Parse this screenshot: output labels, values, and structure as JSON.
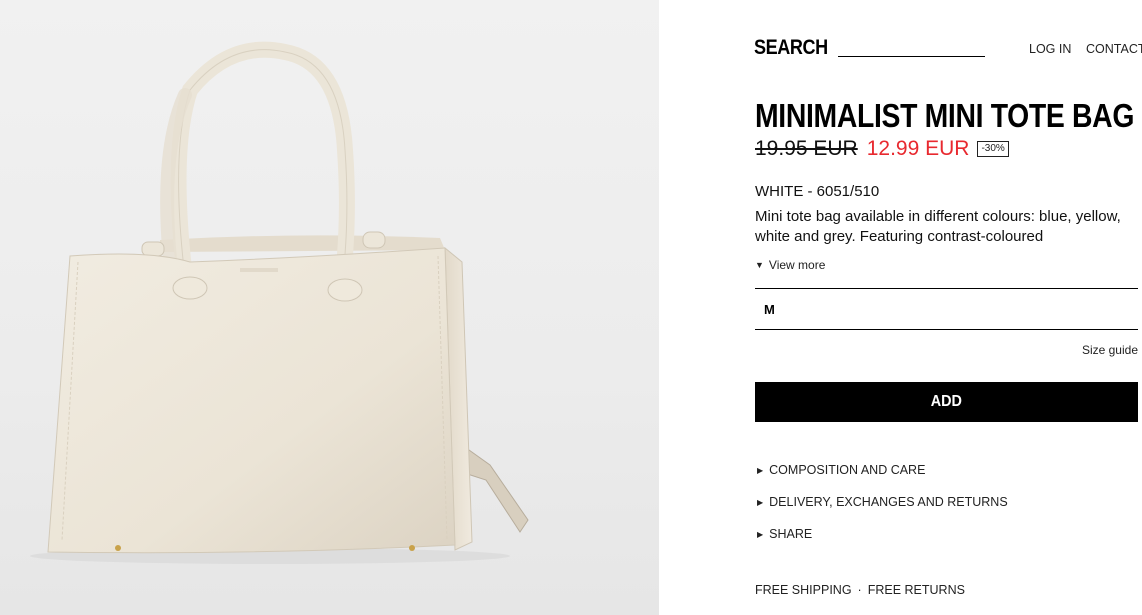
{
  "header": {
    "search_label": "SEARCH",
    "login_label": "LOG IN",
    "contact_label": "CONTACT"
  },
  "product": {
    "title": "MINIMALIST MINI TOTE BAG",
    "price_old": "19.95 EUR",
    "price_new": "12.99 EUR",
    "discount_badge": "-30%",
    "color_ref": "WHITE - 6051/510",
    "description": "Mini tote bag available in different colours: blue, yellow, white and grey. Featuring contrast-coloured",
    "view_more": "View more",
    "size_selected": "M",
    "size_guide": "Size guide",
    "add_label": "ADD",
    "image_name": "product-image"
  },
  "accordion": [
    {
      "label": "COMPOSITION AND CARE"
    },
    {
      "label": "DELIVERY, EXCHANGES AND RETURNS"
    },
    {
      "label": "SHARE"
    }
  ],
  "footer": {
    "shipping": "FREE SHIPPING",
    "separator": "·",
    "returns": "FREE RETURNS"
  },
  "colors": {
    "sale_red": "#e8292f",
    "button_black": "#000000",
    "image_bg": "#ededed",
    "bag_cream": "#efe9dc"
  }
}
